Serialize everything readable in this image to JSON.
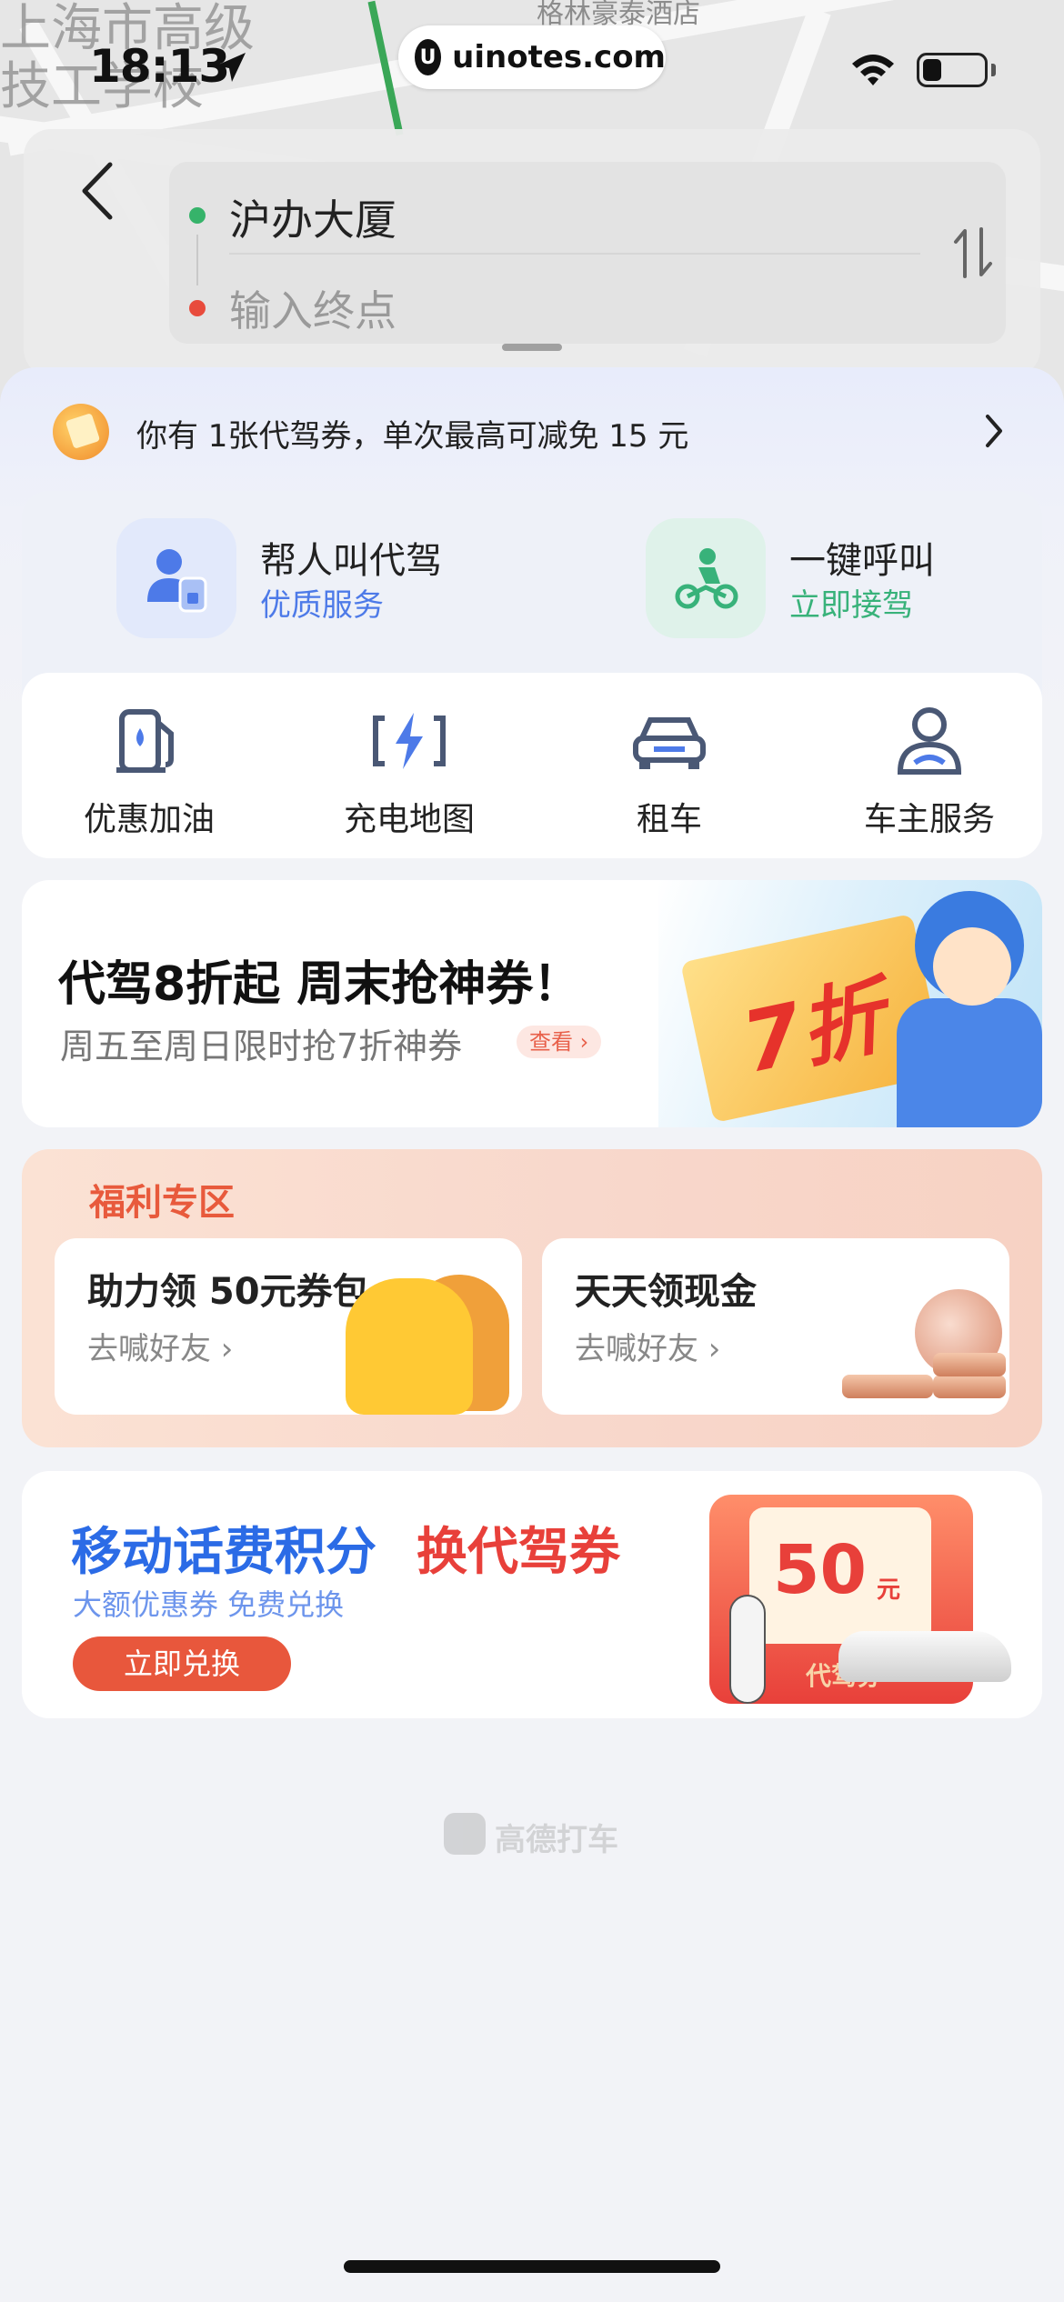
{
  "status_bar": {
    "time": "18:13",
    "url": "uinotes.com",
    "url_logo": "U"
  },
  "map": {
    "label_line1": "上海市高级",
    "label_line2": "技工学校",
    "poi": "格林豪泰酒店"
  },
  "route": {
    "origin": "沪办大厦",
    "destination_placeholder": "输入终点"
  },
  "coupon_bar": {
    "text": "你有 1张代驾券，单次最高可减免 15 元"
  },
  "services": [
    {
      "title": "帮人叫代驾",
      "subtitle": "优质服务",
      "icon": "person-phone-icon",
      "color": "#4d7ae8"
    },
    {
      "title": "一键呼叫",
      "subtitle": "立即接驾",
      "icon": "scooter-rider-icon",
      "color": "#38b27a"
    }
  ],
  "quick_actions": [
    {
      "label": "优惠加油",
      "icon": "fuel-pump-icon"
    },
    {
      "label": "充电地图",
      "icon": "charging-icon"
    },
    {
      "label": "租车",
      "icon": "car-icon"
    },
    {
      "label": "车主服务",
      "icon": "driver-service-icon"
    }
  ],
  "promo_banner": {
    "title": "代驾8折起 周末抢神券！",
    "subtitle": "周五至周日限时抢7折神券",
    "more": "查看 ›",
    "ticket_text": "7折"
  },
  "welfare": {
    "title": "福利专区",
    "cards": [
      {
        "title": "助力领 50元券包",
        "subtitle": "去喊好友 ›"
      },
      {
        "title": "天天领现金",
        "subtitle": "去喊好友 ›"
      }
    ]
  },
  "exchange_banner": {
    "title_a": "移动话费积分",
    "title_b": "换代驾券",
    "subtitle": "大额优惠券 免费兑换",
    "button": "立即兑换",
    "amount": "50",
    "unit": "元",
    "voucher_label": "代驾券"
  },
  "footer": {
    "brand": "高德打车"
  },
  "colors": {
    "accent_blue": "#2b6be6",
    "accent_red": "#e8403a",
    "accent_green": "#38b27a"
  }
}
